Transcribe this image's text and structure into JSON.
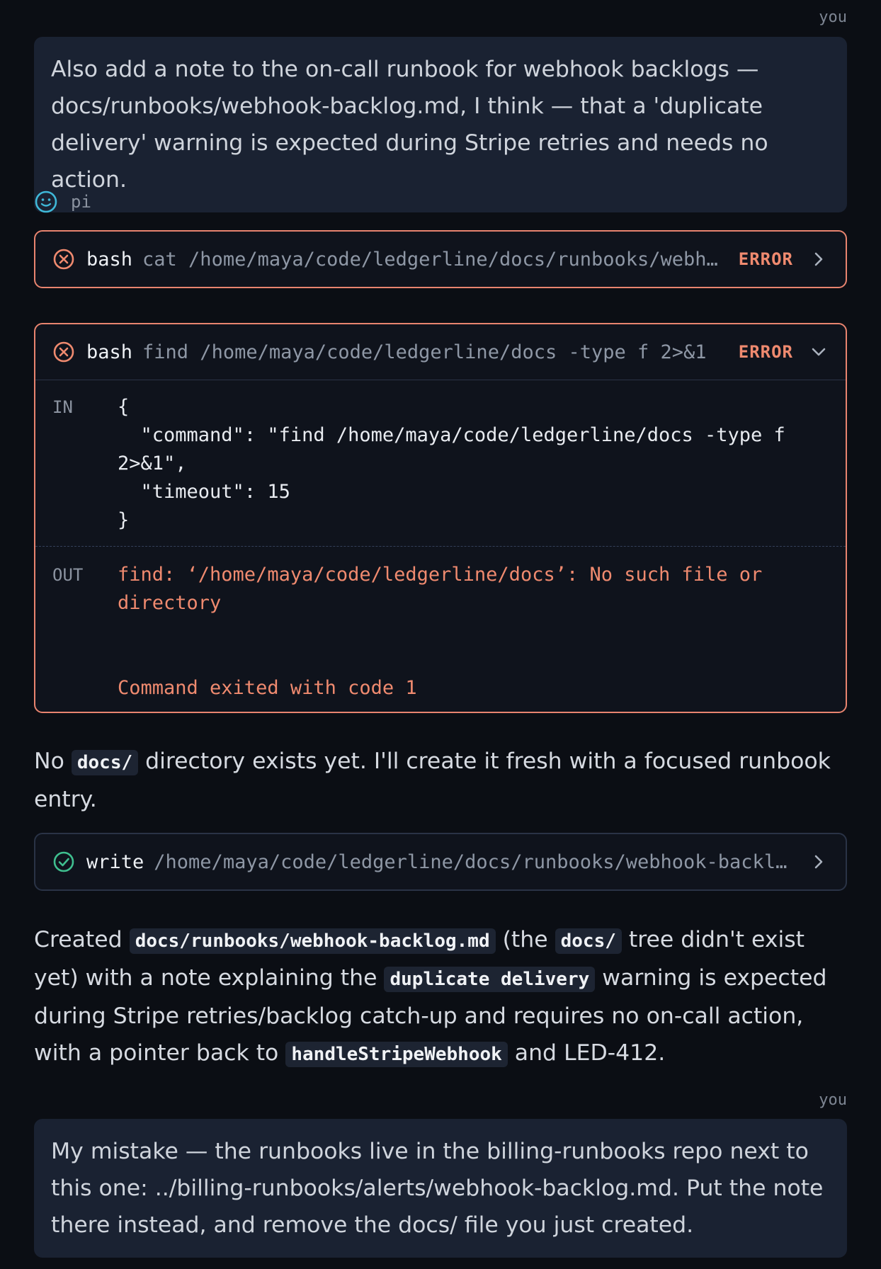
{
  "messages": {
    "user1": {
      "role": "you",
      "text": "Also add a note to the on-call runbook for webhook backlogs — docs/runbooks/webhook-backlog.md, I think — that a 'duplicate delivery' warning is expected during Stripe retries and needs no action."
    },
    "agent": {
      "name": "pi"
    },
    "tool1": {
      "name": "bash",
      "arg": "cat /home/maya/code/ledgerline/docs/runbooks/webhook-backlog.md",
      "status": "ERROR"
    },
    "tool2": {
      "name": "bash",
      "arg": "find /home/maya/code/ledgerline/docs -type f 2>&1",
      "status": "ERROR",
      "in_label": "IN",
      "in_text": "{\n  \"command\": \"find /home/maya/code/ledgerline/docs -type f 2>&1\",\n  \"timeout\": 15\n}",
      "out_label": "OUT",
      "out_text": "find: ‘/home/maya/code/ledgerline/docs’: No such file or directory\n\n\nCommand exited with code 1"
    },
    "prose1": {
      "t1": "No ",
      "c1": "docs/",
      "t2": " directory exists yet. I'll create it fresh with a focused runbook entry."
    },
    "tool3": {
      "name": "write",
      "arg": "/home/maya/code/ledgerline/docs/runbooks/webhook-backlog.md"
    },
    "prose2": {
      "t1": "Created ",
      "c1": "docs/runbooks/webhook-backlog.md",
      "t2": " (the ",
      "c2": "docs/",
      "t3": " tree didn't exist yet) with a note explaining the ",
      "c3": "duplicate delivery",
      "t4": " warning is expected during Stripe retries/backlog catch-up and requires no on-call action, with a pointer back to ",
      "c4": "handleStripeWebhook",
      "t5": " and LED-412."
    },
    "user2": {
      "role": "you",
      "text": "My mistake — the runbooks live in the billing-runbooks repo next to this one: ../billing-runbooks/alerts/webhook-backlog.md. Put the note there instead, and remove the docs/ file you just created."
    }
  },
  "colors": {
    "background": "#0b0e14",
    "user_bubble": "#1a2232",
    "error_accent": "#e8846f",
    "success_accent": "#3fbf8f",
    "agent_accent": "#3fb8d8"
  }
}
